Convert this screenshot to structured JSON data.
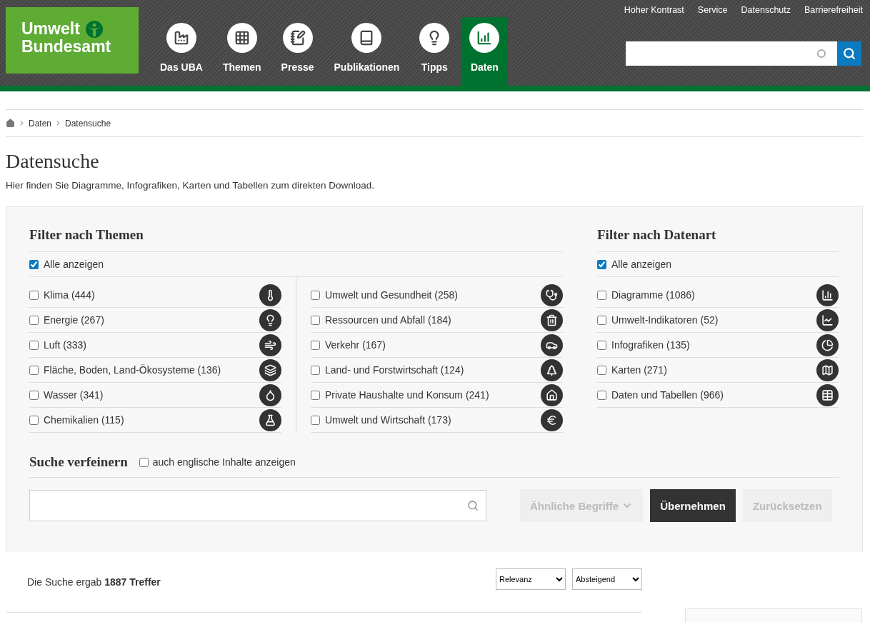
{
  "header": {
    "logo": {
      "line_1": "Umwelt",
      "line_2": "Bundesamt"
    },
    "top_links": [
      "Hoher Kontrast",
      "Service",
      "Datenschutz",
      "Barrierefreiheit"
    ],
    "nav": [
      {
        "label": "Das UBA",
        "selected": false
      },
      {
        "label": "Themen",
        "selected": false
      },
      {
        "label": "Presse",
        "selected": false
      },
      {
        "label": "Publikationen",
        "selected": false
      },
      {
        "label": "Tipps",
        "selected": false
      },
      {
        "label": "Daten",
        "selected": true
      }
    ]
  },
  "breadcrumb": [
    "Daten",
    "Datensuche"
  ],
  "page_title": "Datensuche",
  "intro": "Hier finden Sie Diagramme, Infografiken, Karten und Tabellen zum direkten Download.",
  "filter_themes": {
    "title": "Filter nach Themen",
    "show_all": {
      "label": "Alle anzeigen",
      "checked": true
    },
    "columns": [
      [
        {
          "label": "Klima (444)",
          "checked": false
        },
        {
          "label": "Energie (267)",
          "checked": false
        },
        {
          "label": "Luft (333)",
          "checked": false
        },
        {
          "label": "Fläche, Boden, Land-Ökosysteme (136)",
          "checked": false
        },
        {
          "label": "Wasser (341)",
          "checked": false
        },
        {
          "label": "Chemikalien (115)",
          "checked": false
        }
      ],
      [
        {
          "label": "Umwelt und Gesundheit (258)",
          "checked": false
        },
        {
          "label": "Ressourcen und Abfall (184)",
          "checked": false
        },
        {
          "label": "Verkehr (167)",
          "checked": false
        },
        {
          "label": "Land- und Forstwirtschaft (124)",
          "checked": false
        },
        {
          "label": "Private Haushalte und Konsum (241)",
          "checked": false
        },
        {
          "label": "Umwelt und Wirtschaft (173)",
          "checked": false
        }
      ]
    ]
  },
  "filter_types": {
    "title": "Filter nach Datenart",
    "show_all": {
      "label": "Alle anzeigen",
      "checked": true
    },
    "items": [
      {
        "label": "Diagramme (1086)",
        "checked": false
      },
      {
        "label": "Umwelt-Indikatoren (52)",
        "checked": false
      },
      {
        "label": "Infografiken (135)",
        "checked": false
      },
      {
        "label": "Karten (271)",
        "checked": false
      },
      {
        "label": "Daten und Tabellen (966)",
        "checked": false
      }
    ]
  },
  "refine": {
    "title": "Suche verfeinern",
    "english": {
      "label": "auch englische Inhalte anzeigen",
      "checked": false
    },
    "buttons": [
      {
        "label": "Ähnliche Begriffe",
        "kind": "dropdown",
        "disabled": true
      },
      {
        "label": "Übernehmen",
        "kind": "plain",
        "disabled": false
      },
      {
        "label": "Zurücksetzen",
        "kind": "plain",
        "disabled": true
      }
    ]
  },
  "results": {
    "summary": "Die Suche ergab **1887 Treffer**",
    "sort_by": "Relevanz",
    "order": "Absteigend"
  }
}
